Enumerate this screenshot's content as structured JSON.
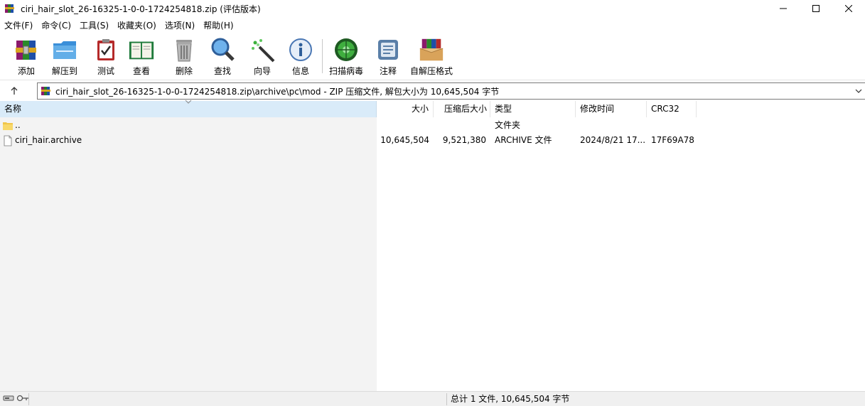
{
  "window": {
    "title": "ciri_hair_slot_26-16325-1-0-0-1724254818.zip (评估版本)",
    "app_icon": "winrar-icon",
    "buttons": [
      "minimize-icon",
      "maximize-icon",
      "close-icon"
    ]
  },
  "menu": [
    "文件(F)",
    "命令(C)",
    "工具(S)",
    "收藏夹(O)",
    "选项(N)",
    "帮助(H)"
  ],
  "toolbar": [
    {
      "label": "添加",
      "icon": "add-archive-icon"
    },
    {
      "label": "解压到",
      "icon": "extract-folder-icon"
    },
    {
      "label": "测试",
      "icon": "test-clipboard-icon"
    },
    {
      "label": "查看",
      "icon": "view-book-icon"
    },
    {
      "label": "删除",
      "icon": "trash-icon"
    },
    {
      "label": "查找",
      "icon": "magnifier-icon"
    },
    {
      "label": "向导",
      "icon": "wizard-wand-icon"
    },
    {
      "label": "信息",
      "icon": "info-icon"
    },
    {
      "label": "扫描病毒",
      "icon": "virus-scan-icon"
    },
    {
      "label": "注释",
      "icon": "comment-icon"
    },
    {
      "label": "自解压格式",
      "icon": "sfx-box-icon"
    }
  ],
  "address": {
    "path": "ciri_hair_slot_26-16325-1-0-0-1724254818.zip\\archive\\pc\\mod - ZIP 压缩文件, 解包大小为 10,645,504 字节"
  },
  "columns": {
    "name": "名称",
    "size": "大小",
    "packed": "压缩后大小",
    "type": "类型",
    "mtime": "修改时间",
    "crc": "CRC32"
  },
  "rows": [
    {
      "name": "..",
      "size": "",
      "packed": "",
      "type": "文件夹",
      "mtime": "",
      "crc": "",
      "icon": "folder-icon"
    },
    {
      "name": "ciri_hair.archive",
      "size": "10,645,504",
      "packed": "9,521,380",
      "type": "ARCHIVE 文件",
      "mtime": "2024/8/21 17...",
      "crc": "17F69A78",
      "icon": "file-icon"
    }
  ],
  "status": {
    "summary": "总计 1 文件, 10,645,504 字节"
  },
  "colors": {
    "header_selected": "#d9ebf9",
    "statusbar": "#f0f0f0"
  }
}
